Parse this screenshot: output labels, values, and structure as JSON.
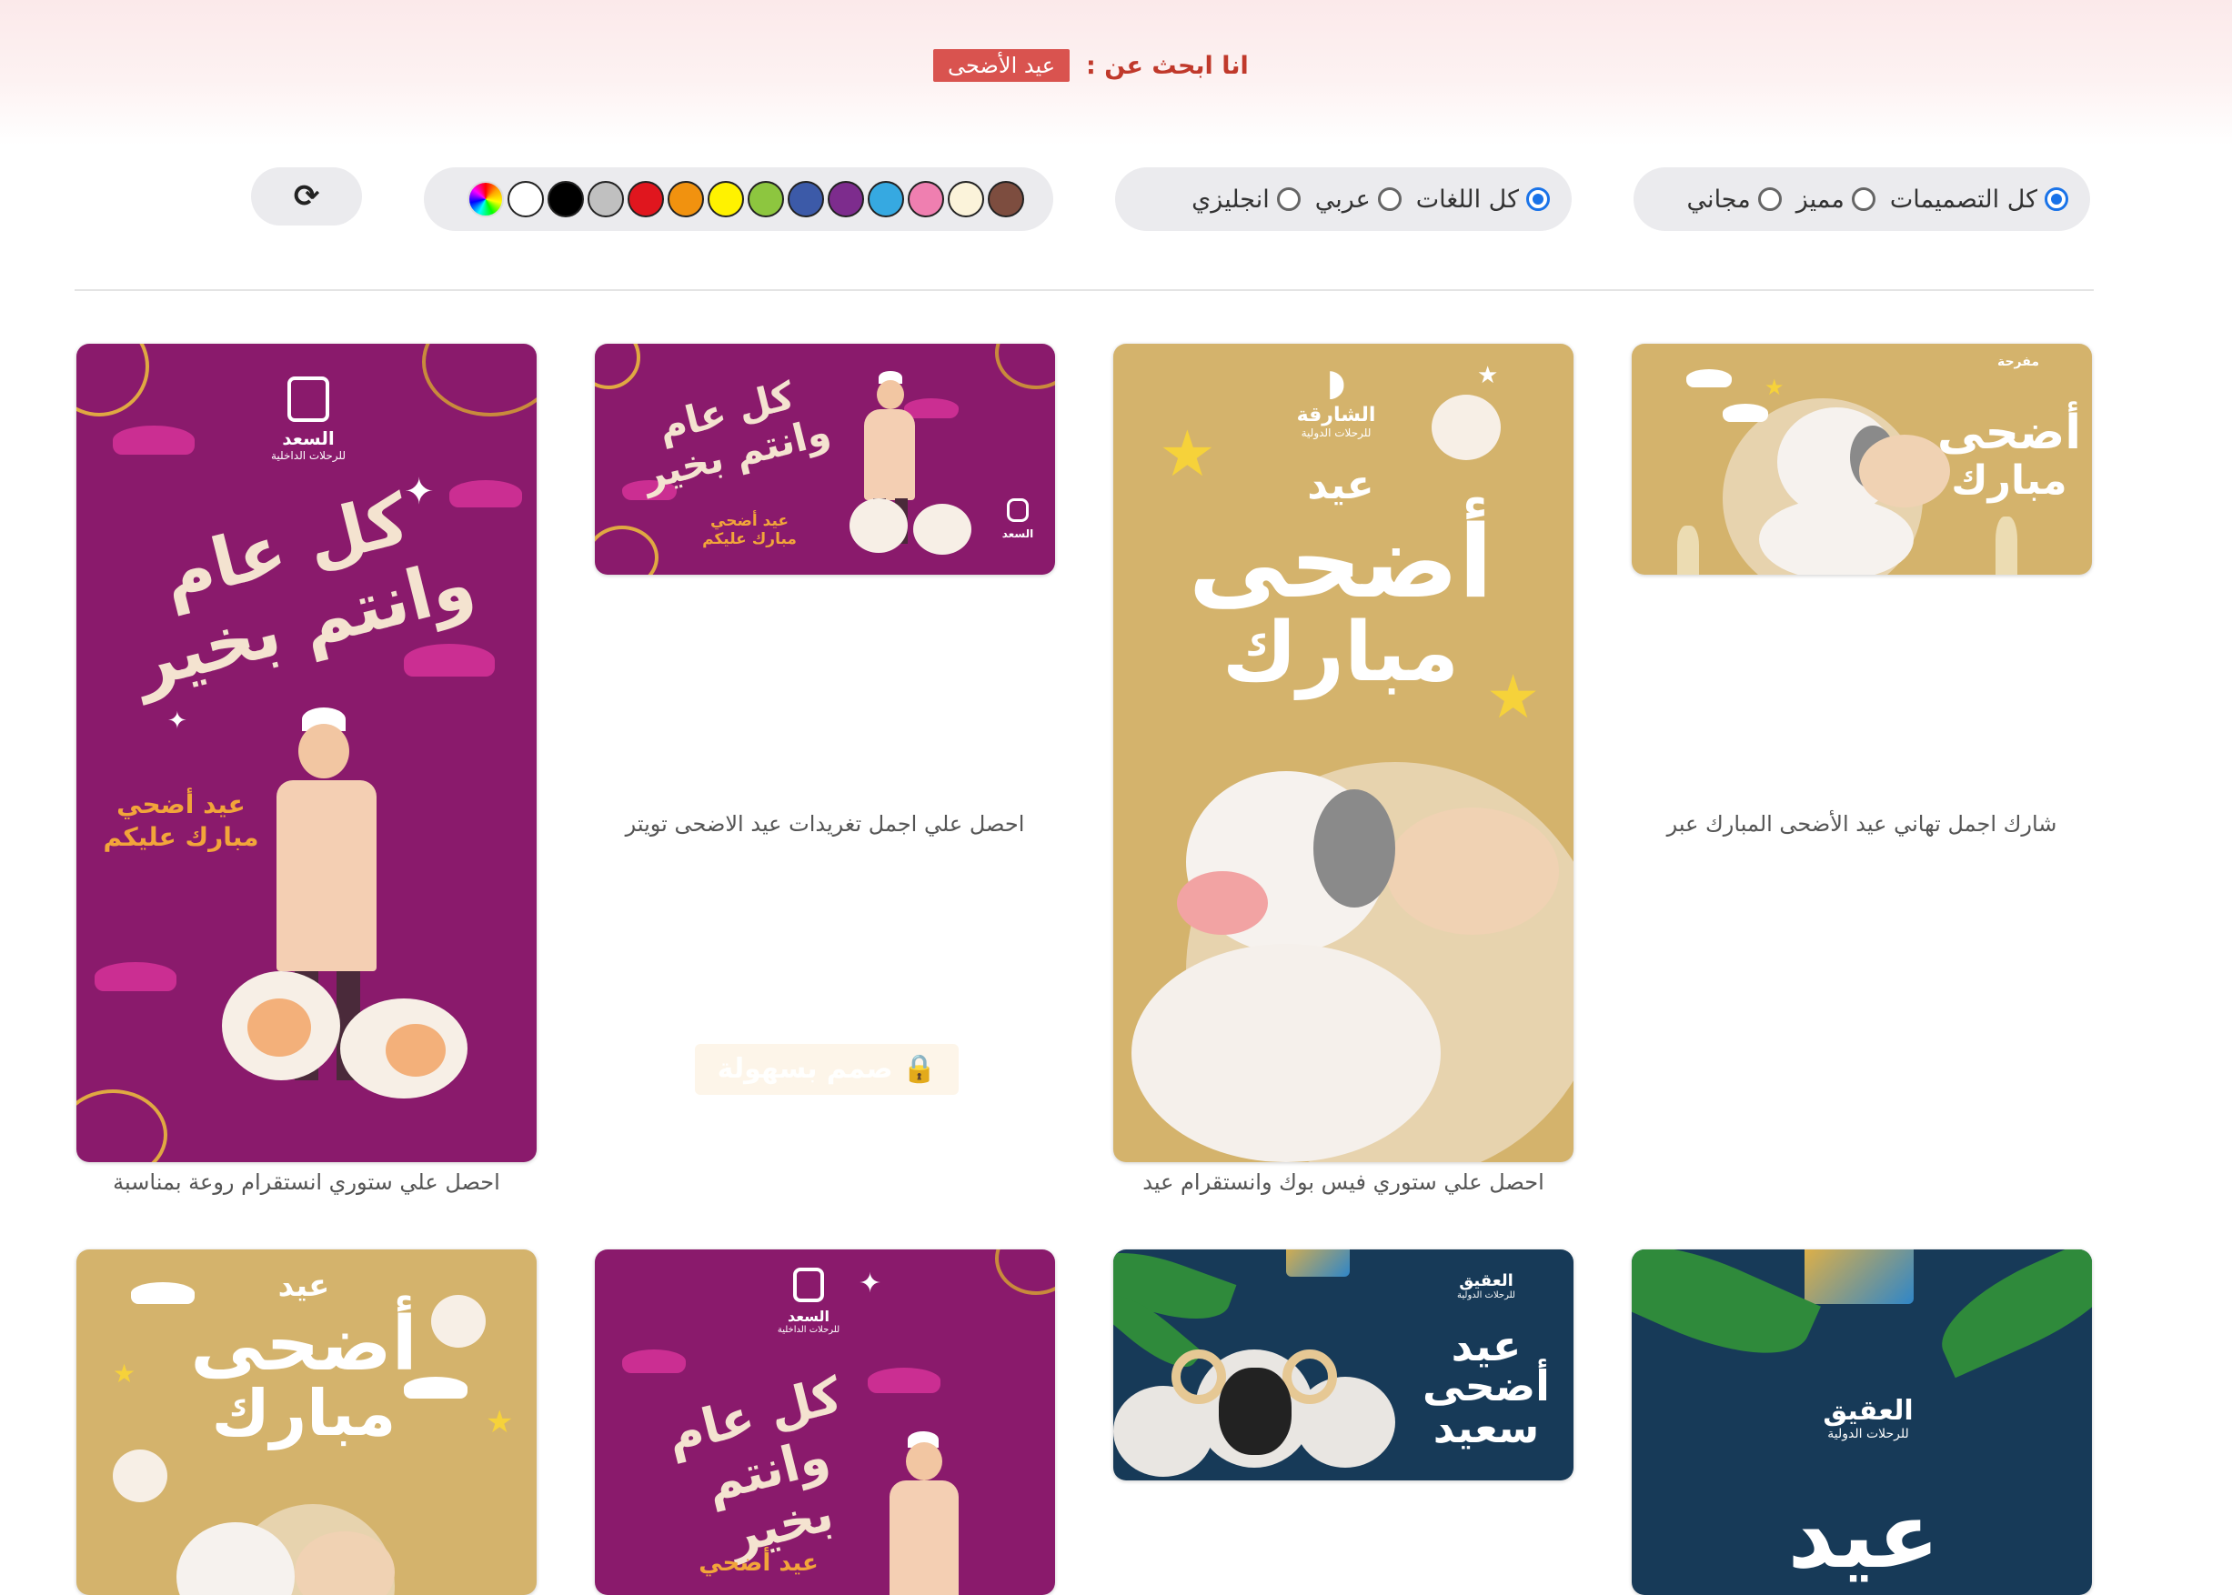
{
  "search": {
    "label": "انا ابحث عن :",
    "term": "عيد الأضحى"
  },
  "filters": {
    "type": [
      {
        "label": "كل التصميمات",
        "selected": true
      },
      {
        "label": "مميز",
        "selected": false
      },
      {
        "label": "مجاني",
        "selected": false
      }
    ],
    "language": [
      {
        "label": "كل اللغات",
        "selected": true
      },
      {
        "label": "عربي",
        "selected": false
      },
      {
        "label": "انجليزي",
        "selected": false
      }
    ],
    "colors": [
      "rainbow",
      "#ffffff",
      "#000000",
      "#c0c0c0",
      "#e0161e",
      "#f1920f",
      "#fff200",
      "#8dc63f",
      "#3c5aa8",
      "#7d2c8d",
      "#36a9e1",
      "#ef7fb0",
      "#fbf3da",
      "#7d4d3f"
    ],
    "reset_icon": "refresh-icon"
  },
  "cards": {
    "c1": {
      "caption": "احصل علي ستوري انستقرام روعة بمناسبة",
      "calligraphy": "كل عام وانتم بخير",
      "greeting1": "عيد أضحي",
      "greeting2": "مبارك عليكم",
      "logo": "السعد",
      "logo_sub": "للرحلات الداخلية"
    },
    "c2": {
      "caption": "احصل علي اجمل تغريدات عيد الاضحى تويتر",
      "calligraphy": "كل عام وانتم بخير",
      "greeting1": "عيد أضحي",
      "greeting2": "مبارك عليكم",
      "logo": "السعد",
      "watermark": "صمم بسهولة"
    },
    "c3": {
      "caption": "احصل علي ستوري فيس بوك وانستقرام عيد",
      "eid": "عيد",
      "adha": "أضحى",
      "mubarak": "مبارك",
      "logo": "الشارقة",
      "logo_sub": "للرحلات الدولية"
    },
    "c4": {
      "caption": "شارك اجمل تهاني عيد الأضحى المبارك عبر",
      "adha": "أضحى",
      "mubarak": "مبارك",
      "logo": "مفرحة"
    },
    "c5": {
      "eid": "عيد",
      "adha": "أضحى",
      "mubarak": "مبارك"
    },
    "c6": {
      "calligraphy": "كل عام وانتم بخير",
      "greeting1": "عيد أضحي",
      "logo": "السعد",
      "logo_sub": "للرحلات الداخلية"
    },
    "c7": {
      "line1": "عيد",
      "line2": "أضحى",
      "line3": "سعيد",
      "logo": "العقيق",
      "logo_sub": "للرحلات الدولية"
    },
    "c8": {
      "logo": "العقيق",
      "logo_sub": "للرحلات الدولية",
      "eid": "عيد"
    }
  }
}
